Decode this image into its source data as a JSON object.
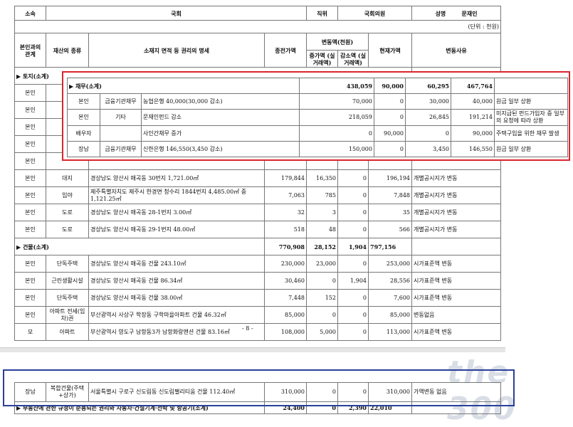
{
  "header": {
    "affiliation_label": "소속",
    "affiliation_value": "국회",
    "position_label": "직위",
    "position_value": "국회의원",
    "name_label": "성명",
    "name_value": "문재인",
    "unit": "(단위 : 천원)"
  },
  "columns": {
    "relation": "본인과의 관계",
    "type": "재산의 종류",
    "desc": "소재지 면적 등 권리의 명세",
    "prev": "종전가액",
    "change": "변동액(천원)",
    "inc": "증가액 (실거래액)",
    "dec": "감소액 (실거래액)",
    "curr": "현재가액",
    "reason": "변동사유"
  },
  "land_section": {
    "label": "▶ 토지(소계)",
    "note": "변동"
  },
  "land_rows": [
    {
      "rel": "본인",
      "type": "",
      "desc": "",
      "prev": "",
      "inc": "",
      "dec": "",
      "curr": "",
      "reason": ""
    },
    {
      "rel": "본인",
      "type": "",
      "desc": "",
      "prev": "",
      "inc": "",
      "dec": "",
      "curr": "",
      "reason": ""
    },
    {
      "rel": "본인",
      "type": "",
      "desc": "",
      "prev": "",
      "inc": "",
      "dec": "",
      "curr": "",
      "reason": ""
    },
    {
      "rel": "본인",
      "type": "",
      "desc": "",
      "prev": "",
      "inc": "",
      "dec": "",
      "curr": "",
      "reason": ""
    },
    {
      "rel": "본인",
      "type": "",
      "desc": "",
      "prev": "",
      "inc": "",
      "dec": "",
      "curr": "",
      "reason": ""
    },
    {
      "rel": "본인",
      "type": "대지",
      "desc": "경상남도 양산시 매곡동 30번지 1,721.00㎡",
      "prev": "179,844",
      "inc": "16,350",
      "dec": "0",
      "curr": "196,194",
      "reason": "개별공시지가 변동"
    },
    {
      "rel": "본인",
      "type": "임야",
      "desc": "제주특별자치도 제주시 한경면 청수리 1844번지 4,485.00㎡ 중 1,121.25㎡",
      "prev": "7,063",
      "inc": "785",
      "dec": "0",
      "curr": "7,848",
      "reason": "개별공시지가 변동"
    },
    {
      "rel": "본인",
      "type": "도로",
      "desc": "경상남도 양산시 매곡동 28-1번지 3.00㎡",
      "prev": "32",
      "inc": "3",
      "dec": "0",
      "curr": "35",
      "reason": "개별공시지가 변동"
    },
    {
      "rel": "본인",
      "type": "도로",
      "desc": "경상남도 양산시 매곡동 29-1번지 48.00㎡",
      "prev": "518",
      "inc": "48",
      "dec": "0",
      "curr": "566",
      "reason": "개별공시지가 변동"
    }
  ],
  "building_section": {
    "label": "▶ 건물(소계)",
    "prev": "770,908",
    "inc": "28,152",
    "dec": "1,904",
    "curr": "797,156"
  },
  "building_rows": [
    {
      "rel": "본인",
      "type": "단독주택",
      "desc": "경상남도 양산시 매곡동 건물 243.10㎡",
      "prev": "230,000",
      "inc": "23,000",
      "dec": "0",
      "curr": "253,000",
      "reason": "시가표준액 변동"
    },
    {
      "rel": "본인",
      "type": "근린생활시설",
      "desc": "경상남도 양산시 매곡동 건물 86.34㎡",
      "prev": "30,460",
      "inc": "0",
      "dec": "1,904",
      "curr": "28,556",
      "reason": "시가표준액 변동"
    },
    {
      "rel": "본인",
      "type": "단독주택",
      "desc": "경상남도 양산시 매곡동 건물 38.00㎡",
      "prev": "7,448",
      "inc": "152",
      "dec": "0",
      "curr": "7,600",
      "reason": "시가표준액 변동"
    },
    {
      "rel": "본인",
      "type": "아파트 전세(임차)권",
      "desc": "부산광역시 사상구 학장동 구학마을아파트 건물 46.32㎡",
      "prev": "85,000",
      "inc": "0",
      "dec": "0",
      "curr": "85,000",
      "reason": "변동없음"
    },
    {
      "rel": "모",
      "type": "아파트",
      "desc": "부산광역시 영도구 남항동3가 남항화랑맨션 건물 83.16㎡",
      "prev": "108,000",
      "inc": "5,000",
      "dec": "0",
      "curr": "113,000",
      "reason": "시가표준액 변동"
    }
  ],
  "debt_section": {
    "label": "▶ 채무(소계)",
    "prev": "438,059",
    "inc": "90,000",
    "dec": "60,295",
    "curr": "467,764"
  },
  "debt_rows": [
    {
      "rel": "본인",
      "type": "금융기관채무",
      "desc": "농협은행 40,000(30,000 감소)",
      "prev": "70,000",
      "inc": "0",
      "dec": "30,000",
      "curr": "40,000",
      "reason": "원금 일부 상환"
    },
    {
      "rel": "본인",
      "type": "기타",
      "desc": "문재인펀드 감소",
      "prev": "218,059",
      "inc": "0",
      "dec": "26,845",
      "curr": "191,214",
      "reason": "미지급된 펀드가입자 중 일부의 요청에 따라 상환"
    },
    {
      "rel": "배우자",
      "type": "",
      "desc": "사인간채무 증가",
      "prev": "0",
      "inc": "90,000",
      "dec": "0",
      "curr": "90,000",
      "reason": "주택구입을 위한 채무 발생"
    },
    {
      "rel": "장남",
      "type": "금융기관채무",
      "desc": "신한은행 146,550(3,450 감소)",
      "prev": "150,000",
      "inc": "0",
      "dec": "3,450",
      "curr": "146,550",
      "reason": "원금 일부 상환"
    }
  ],
  "page_number": "- 8 -",
  "bottom_row": {
    "rel": "장남",
    "type": "복합건물(주택+상가)",
    "desc": "서울특별시 구로구 신도림동 신도림팰리티움 건물 112.40㎡",
    "prev": "310,000",
    "inc": "0",
    "dec": "0",
    "curr": "310,000",
    "reason": "가액변동 없음"
  },
  "bottom_section": {
    "label": "▶ 부동산에 관한 규정이 준용되는 권리와 자동차·건설기계·선박 및 항공기(소계)",
    "prev": "24,400",
    "inc": "0",
    "dec": "2,390",
    "curr": "22,010"
  },
  "watermark": "the 300"
}
